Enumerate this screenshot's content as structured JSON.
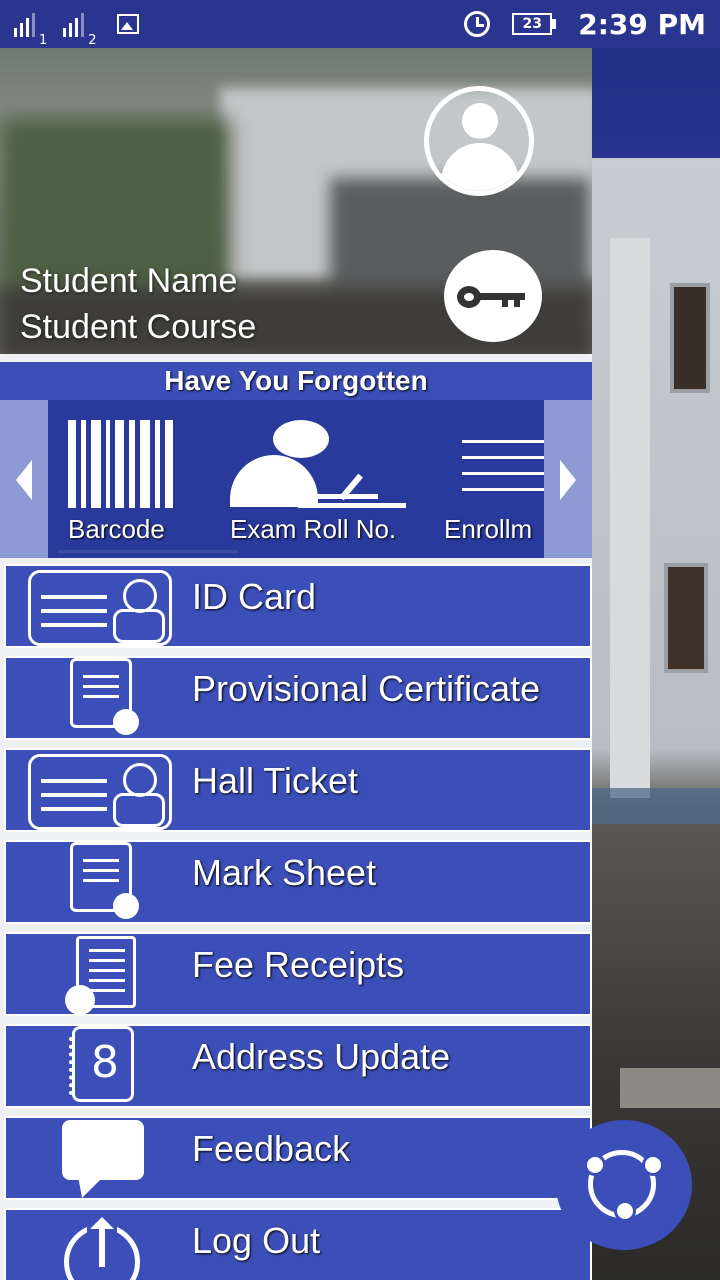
{
  "status_bar": {
    "sim1": "1",
    "sim2": "2",
    "battery": "23",
    "time": "2:39 PM",
    "icons": [
      "signal-icon",
      "gallery-icon",
      "alarm-icon",
      "battery-icon"
    ]
  },
  "header": {
    "student_name": "Student Name",
    "student_course": "Student Course",
    "icons": [
      "avatar-icon",
      "key-icon"
    ]
  },
  "forgot": {
    "title": "Have You Forgotten",
    "items": [
      {
        "label": "Barcode",
        "icon": "barcode-icon"
      },
      {
        "label": "Exam Roll No.",
        "icon": "exam-writing-icon"
      },
      {
        "label": "Enrollm",
        "icon": "enrollment-lines-icon"
      }
    ]
  },
  "menu": [
    {
      "label": "ID Card",
      "icon": "id-card-icon"
    },
    {
      "label": "Provisional Certificate",
      "icon": "certificate-icon"
    },
    {
      "label": "Hall Ticket",
      "icon": "id-card-icon"
    },
    {
      "label": "Mark Sheet",
      "icon": "certificate-icon"
    },
    {
      "label": "Fee Receipts",
      "icon": "receipt-icon"
    },
    {
      "label": "Address Update",
      "icon": "address-book-icon"
    },
    {
      "label": "Feedback",
      "icon": "chat-bubble-icon"
    },
    {
      "label": "Log Out",
      "icon": "power-icon"
    }
  ],
  "colors": {
    "primary": "#3c4fb8",
    "dark_primary": "#2a3590",
    "carousel_bg": "#2a3a9c",
    "arrow_bg": "#8e9ad6"
  }
}
